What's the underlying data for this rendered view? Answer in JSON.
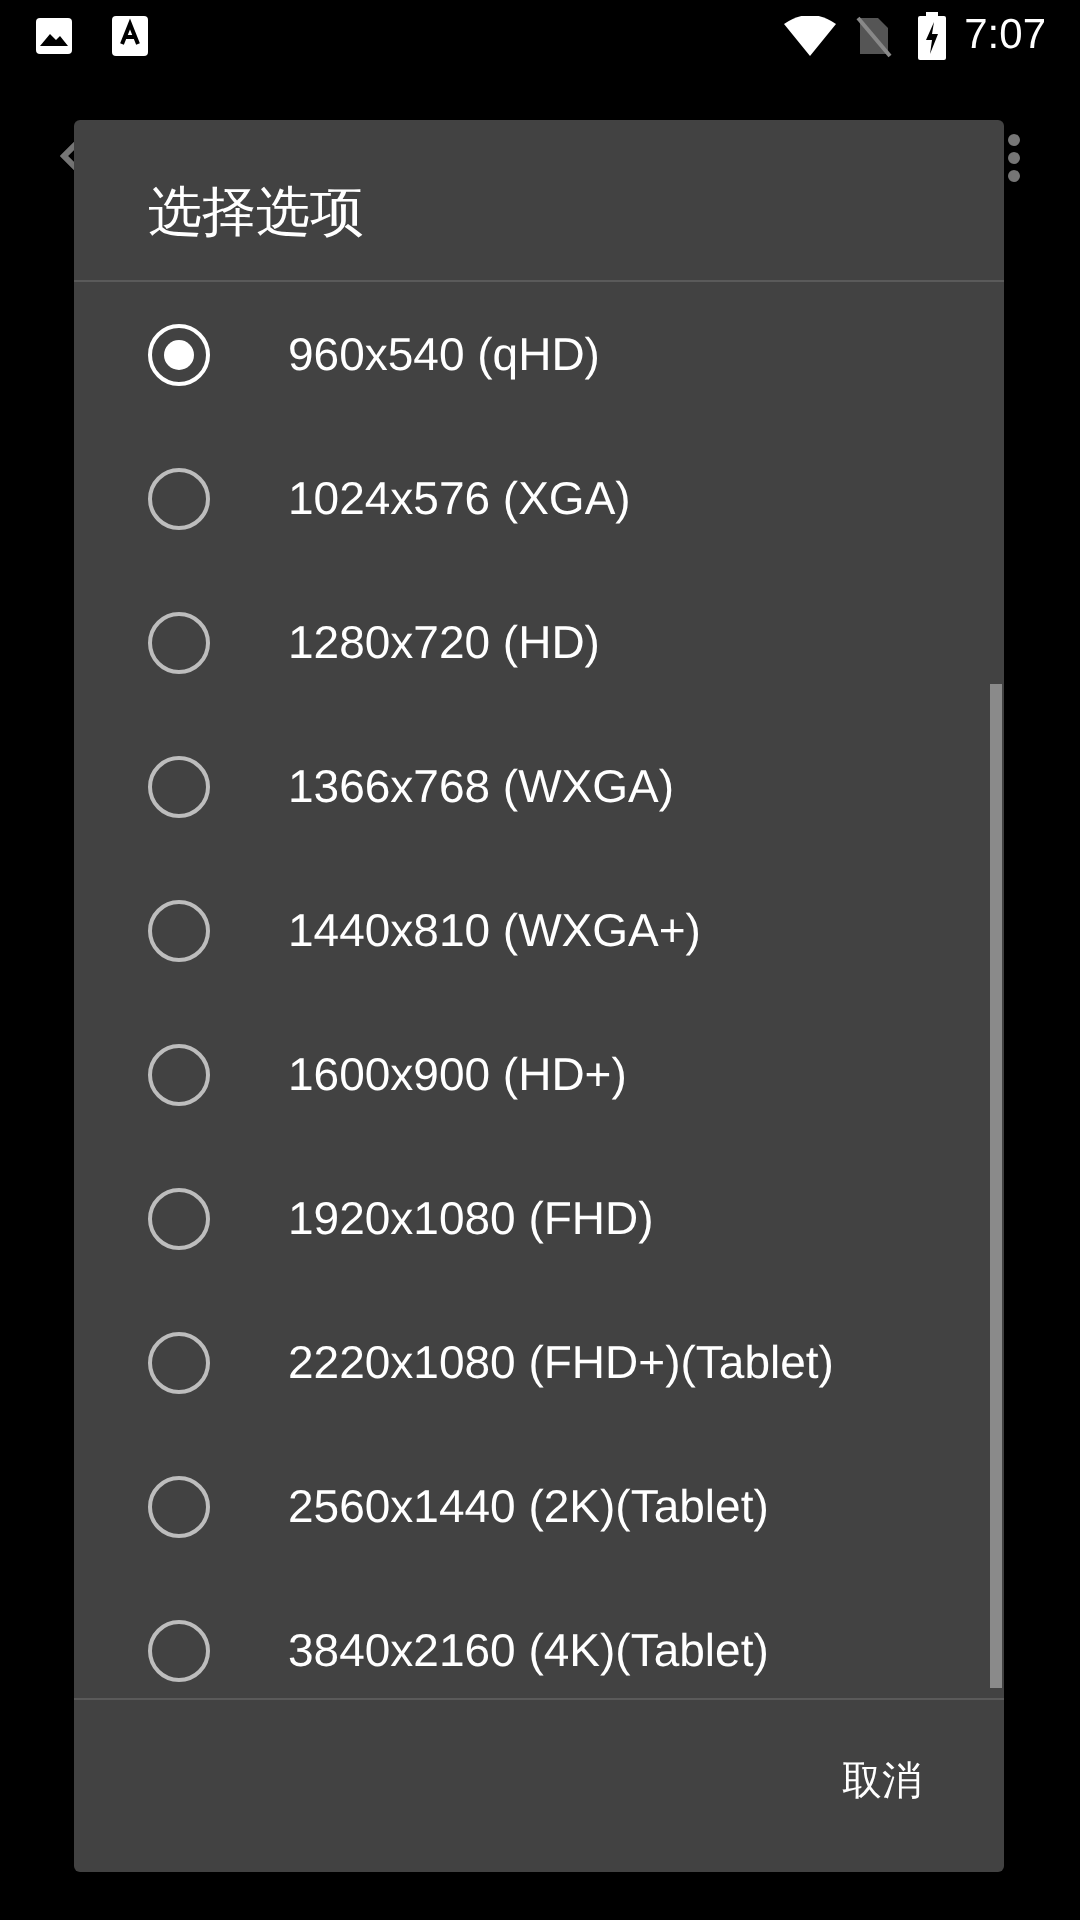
{
  "status_bar": {
    "time": "7:07"
  },
  "dialog": {
    "title": "选择选项",
    "options": [
      {
        "label": "960x540 (qHD)",
        "selected": true
      },
      {
        "label": "1024x576 (XGA)",
        "selected": false
      },
      {
        "label": "1280x720 (HD)",
        "selected": false
      },
      {
        "label": "1366x768 (WXGA)",
        "selected": false
      },
      {
        "label": "1440x810 (WXGA+)",
        "selected": false
      },
      {
        "label": "1600x900 (HD+)",
        "selected": false
      },
      {
        "label": "1920x1080 (FHD)",
        "selected": false
      },
      {
        "label": "2220x1080 (FHD+)(Tablet)",
        "selected": false
      },
      {
        "label": "2560x1440 (2K)(Tablet)",
        "selected": false
      },
      {
        "label": "3840x2160 (4K)(Tablet)",
        "selected": false
      }
    ],
    "cancel": "取消"
  }
}
